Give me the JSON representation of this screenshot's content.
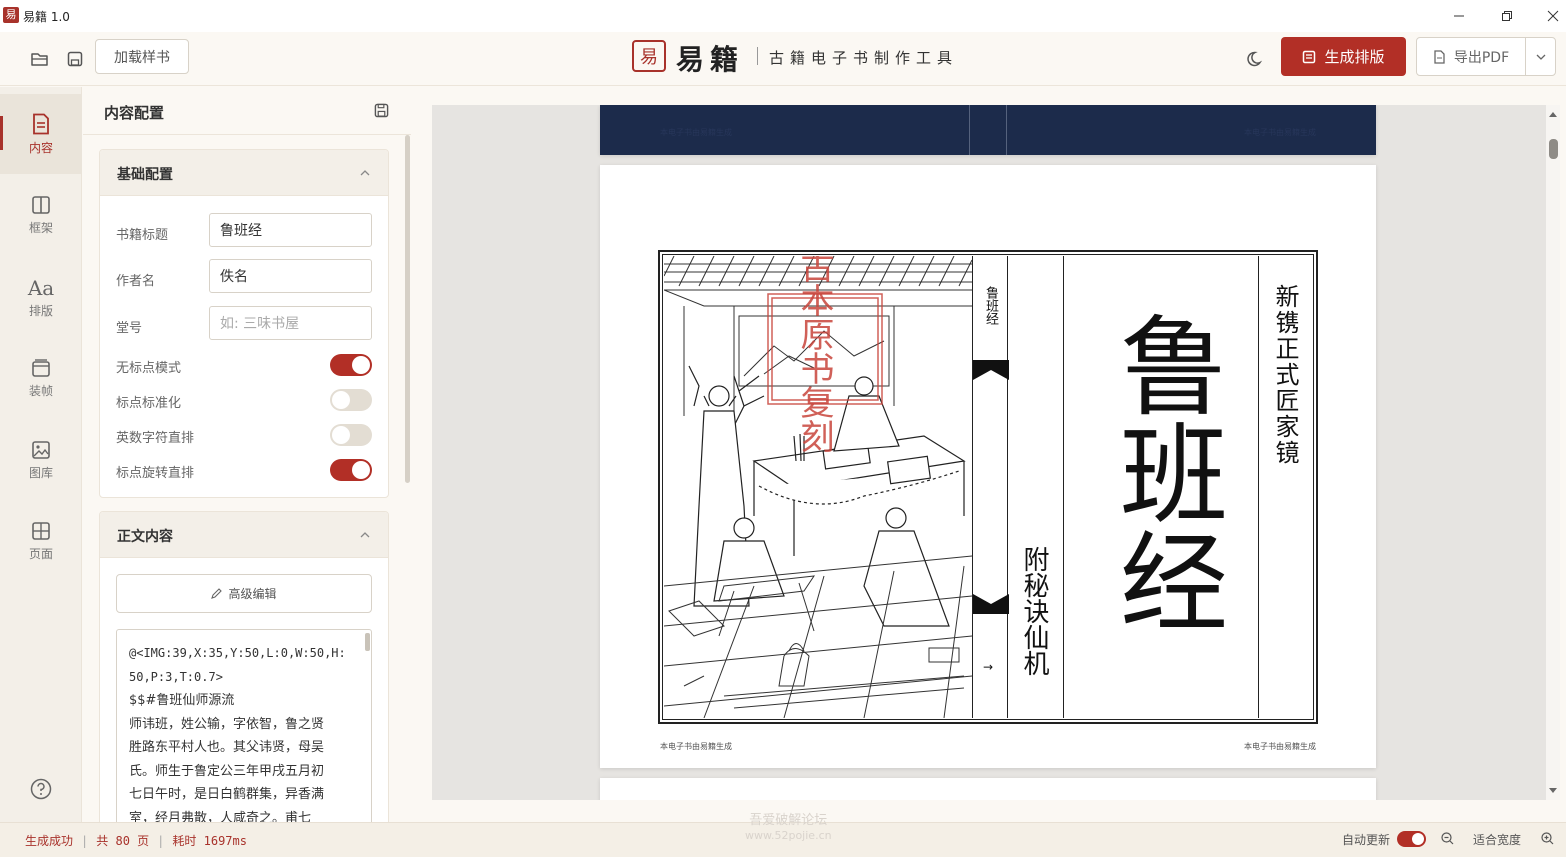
{
  "window": {
    "title": "易籍 1.0",
    "app_icon": "易"
  },
  "toolbar": {
    "load_sample": "加载样书",
    "brand_seal": "易",
    "brand_name": "易籍",
    "brand_sub": "古籍电子书制作工具",
    "generate": "生成排版",
    "export": "导出PDF"
  },
  "nav": [
    {
      "label": "内容",
      "icon": "document-icon"
    },
    {
      "label": "框架",
      "icon": "frame-icon"
    },
    {
      "label": "排版",
      "icon": "typography-icon"
    },
    {
      "label": "装帧",
      "icon": "binding-icon"
    },
    {
      "label": "图库",
      "icon": "image-icon"
    },
    {
      "label": "页面",
      "icon": "page-layout-icon"
    }
  ],
  "panel": {
    "title": "内容配置",
    "basic": {
      "title": "基础配置",
      "book_title_label": "书籍标题",
      "book_title_value": "鲁班经",
      "author_label": "作者名",
      "author_value": "佚名",
      "hall_label": "堂号",
      "hall_placeholder": "如: 三味书屋",
      "toggles": [
        {
          "label": "无标点模式",
          "on": true
        },
        {
          "label": "标点标准化",
          "on": false
        },
        {
          "label": "英数字符直排",
          "on": false
        },
        {
          "label": "标点旋转直排",
          "on": true
        }
      ]
    },
    "body": {
      "title": "正文内容",
      "advanced_edit": "高级编辑",
      "text_lines": [
        "@<IMG:39,X:35,Y:50,L:0,W:50,H:",
        "50,P:3,T:0.7>",
        "$$#鲁班仙师源流",
        "师讳班，姓公输，字依智，鲁之贤",
        "胜路东平村人也。其父讳贤，母吴",
        "氏。师生于鲁定公三年甲戌五月初",
        "七日午时，是日白鹤群集，异香满",
        "室，经月弗散，人咸奇之。甫七"
      ]
    }
  },
  "preview": {
    "header_left": "本电子书由易籍生成",
    "header_right": "本电子书由易籍生成",
    "side_title": "鲁班经",
    "main_title": "鲁班经",
    "subtitle": "新镌正式匠家镜",
    "appendix": "附秘诀仙机",
    "arrow": "→",
    "seal_text": "古本原书复刻",
    "footer_left": "本电子书由易籍生成",
    "footer_right": "本电子书由易籍生成"
  },
  "status": {
    "result": "生成成功",
    "pages": "共 80 页",
    "elapsed": "耗时 1697ms",
    "auto_update": "自动更新",
    "fit_width": "适合宽度",
    "watermark_1": "吾爱破解论坛",
    "watermark_2": "www.52pojie.cn"
  },
  "colors": {
    "accent": "#b22f26",
    "navy": "#1c2b4b",
    "panel_bg": "#fbf8f3"
  }
}
